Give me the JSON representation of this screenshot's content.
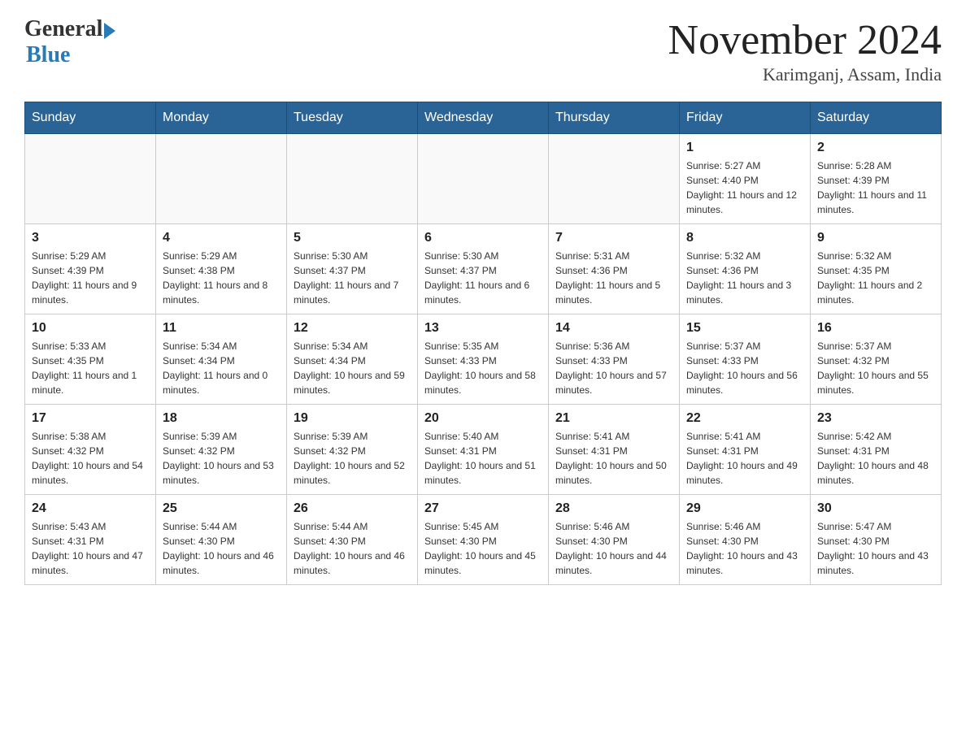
{
  "header": {
    "logo_general": "General",
    "logo_blue": "Blue",
    "title": "November 2024",
    "subtitle": "Karimganj, Assam, India"
  },
  "weekdays": [
    "Sunday",
    "Monday",
    "Tuesday",
    "Wednesday",
    "Thursday",
    "Friday",
    "Saturday"
  ],
  "weeks": [
    [
      {
        "day": "",
        "info": ""
      },
      {
        "day": "",
        "info": ""
      },
      {
        "day": "",
        "info": ""
      },
      {
        "day": "",
        "info": ""
      },
      {
        "day": "",
        "info": ""
      },
      {
        "day": "1",
        "info": "Sunrise: 5:27 AM\nSunset: 4:40 PM\nDaylight: 11 hours and 12 minutes."
      },
      {
        "day": "2",
        "info": "Sunrise: 5:28 AM\nSunset: 4:39 PM\nDaylight: 11 hours and 11 minutes."
      }
    ],
    [
      {
        "day": "3",
        "info": "Sunrise: 5:29 AM\nSunset: 4:39 PM\nDaylight: 11 hours and 9 minutes."
      },
      {
        "day": "4",
        "info": "Sunrise: 5:29 AM\nSunset: 4:38 PM\nDaylight: 11 hours and 8 minutes."
      },
      {
        "day": "5",
        "info": "Sunrise: 5:30 AM\nSunset: 4:37 PM\nDaylight: 11 hours and 7 minutes."
      },
      {
        "day": "6",
        "info": "Sunrise: 5:30 AM\nSunset: 4:37 PM\nDaylight: 11 hours and 6 minutes."
      },
      {
        "day": "7",
        "info": "Sunrise: 5:31 AM\nSunset: 4:36 PM\nDaylight: 11 hours and 5 minutes."
      },
      {
        "day": "8",
        "info": "Sunrise: 5:32 AM\nSunset: 4:36 PM\nDaylight: 11 hours and 3 minutes."
      },
      {
        "day": "9",
        "info": "Sunrise: 5:32 AM\nSunset: 4:35 PM\nDaylight: 11 hours and 2 minutes."
      }
    ],
    [
      {
        "day": "10",
        "info": "Sunrise: 5:33 AM\nSunset: 4:35 PM\nDaylight: 11 hours and 1 minute."
      },
      {
        "day": "11",
        "info": "Sunrise: 5:34 AM\nSunset: 4:34 PM\nDaylight: 11 hours and 0 minutes."
      },
      {
        "day": "12",
        "info": "Sunrise: 5:34 AM\nSunset: 4:34 PM\nDaylight: 10 hours and 59 minutes."
      },
      {
        "day": "13",
        "info": "Sunrise: 5:35 AM\nSunset: 4:33 PM\nDaylight: 10 hours and 58 minutes."
      },
      {
        "day": "14",
        "info": "Sunrise: 5:36 AM\nSunset: 4:33 PM\nDaylight: 10 hours and 57 minutes."
      },
      {
        "day": "15",
        "info": "Sunrise: 5:37 AM\nSunset: 4:33 PM\nDaylight: 10 hours and 56 minutes."
      },
      {
        "day": "16",
        "info": "Sunrise: 5:37 AM\nSunset: 4:32 PM\nDaylight: 10 hours and 55 minutes."
      }
    ],
    [
      {
        "day": "17",
        "info": "Sunrise: 5:38 AM\nSunset: 4:32 PM\nDaylight: 10 hours and 54 minutes."
      },
      {
        "day": "18",
        "info": "Sunrise: 5:39 AM\nSunset: 4:32 PM\nDaylight: 10 hours and 53 minutes."
      },
      {
        "day": "19",
        "info": "Sunrise: 5:39 AM\nSunset: 4:32 PM\nDaylight: 10 hours and 52 minutes."
      },
      {
        "day": "20",
        "info": "Sunrise: 5:40 AM\nSunset: 4:31 PM\nDaylight: 10 hours and 51 minutes."
      },
      {
        "day": "21",
        "info": "Sunrise: 5:41 AM\nSunset: 4:31 PM\nDaylight: 10 hours and 50 minutes."
      },
      {
        "day": "22",
        "info": "Sunrise: 5:41 AM\nSunset: 4:31 PM\nDaylight: 10 hours and 49 minutes."
      },
      {
        "day": "23",
        "info": "Sunrise: 5:42 AM\nSunset: 4:31 PM\nDaylight: 10 hours and 48 minutes."
      }
    ],
    [
      {
        "day": "24",
        "info": "Sunrise: 5:43 AM\nSunset: 4:31 PM\nDaylight: 10 hours and 47 minutes."
      },
      {
        "day": "25",
        "info": "Sunrise: 5:44 AM\nSunset: 4:30 PM\nDaylight: 10 hours and 46 minutes."
      },
      {
        "day": "26",
        "info": "Sunrise: 5:44 AM\nSunset: 4:30 PM\nDaylight: 10 hours and 46 minutes."
      },
      {
        "day": "27",
        "info": "Sunrise: 5:45 AM\nSunset: 4:30 PM\nDaylight: 10 hours and 45 minutes."
      },
      {
        "day": "28",
        "info": "Sunrise: 5:46 AM\nSunset: 4:30 PM\nDaylight: 10 hours and 44 minutes."
      },
      {
        "day": "29",
        "info": "Sunrise: 5:46 AM\nSunset: 4:30 PM\nDaylight: 10 hours and 43 minutes."
      },
      {
        "day": "30",
        "info": "Sunrise: 5:47 AM\nSunset: 4:30 PM\nDaylight: 10 hours and 43 minutes."
      }
    ]
  ]
}
